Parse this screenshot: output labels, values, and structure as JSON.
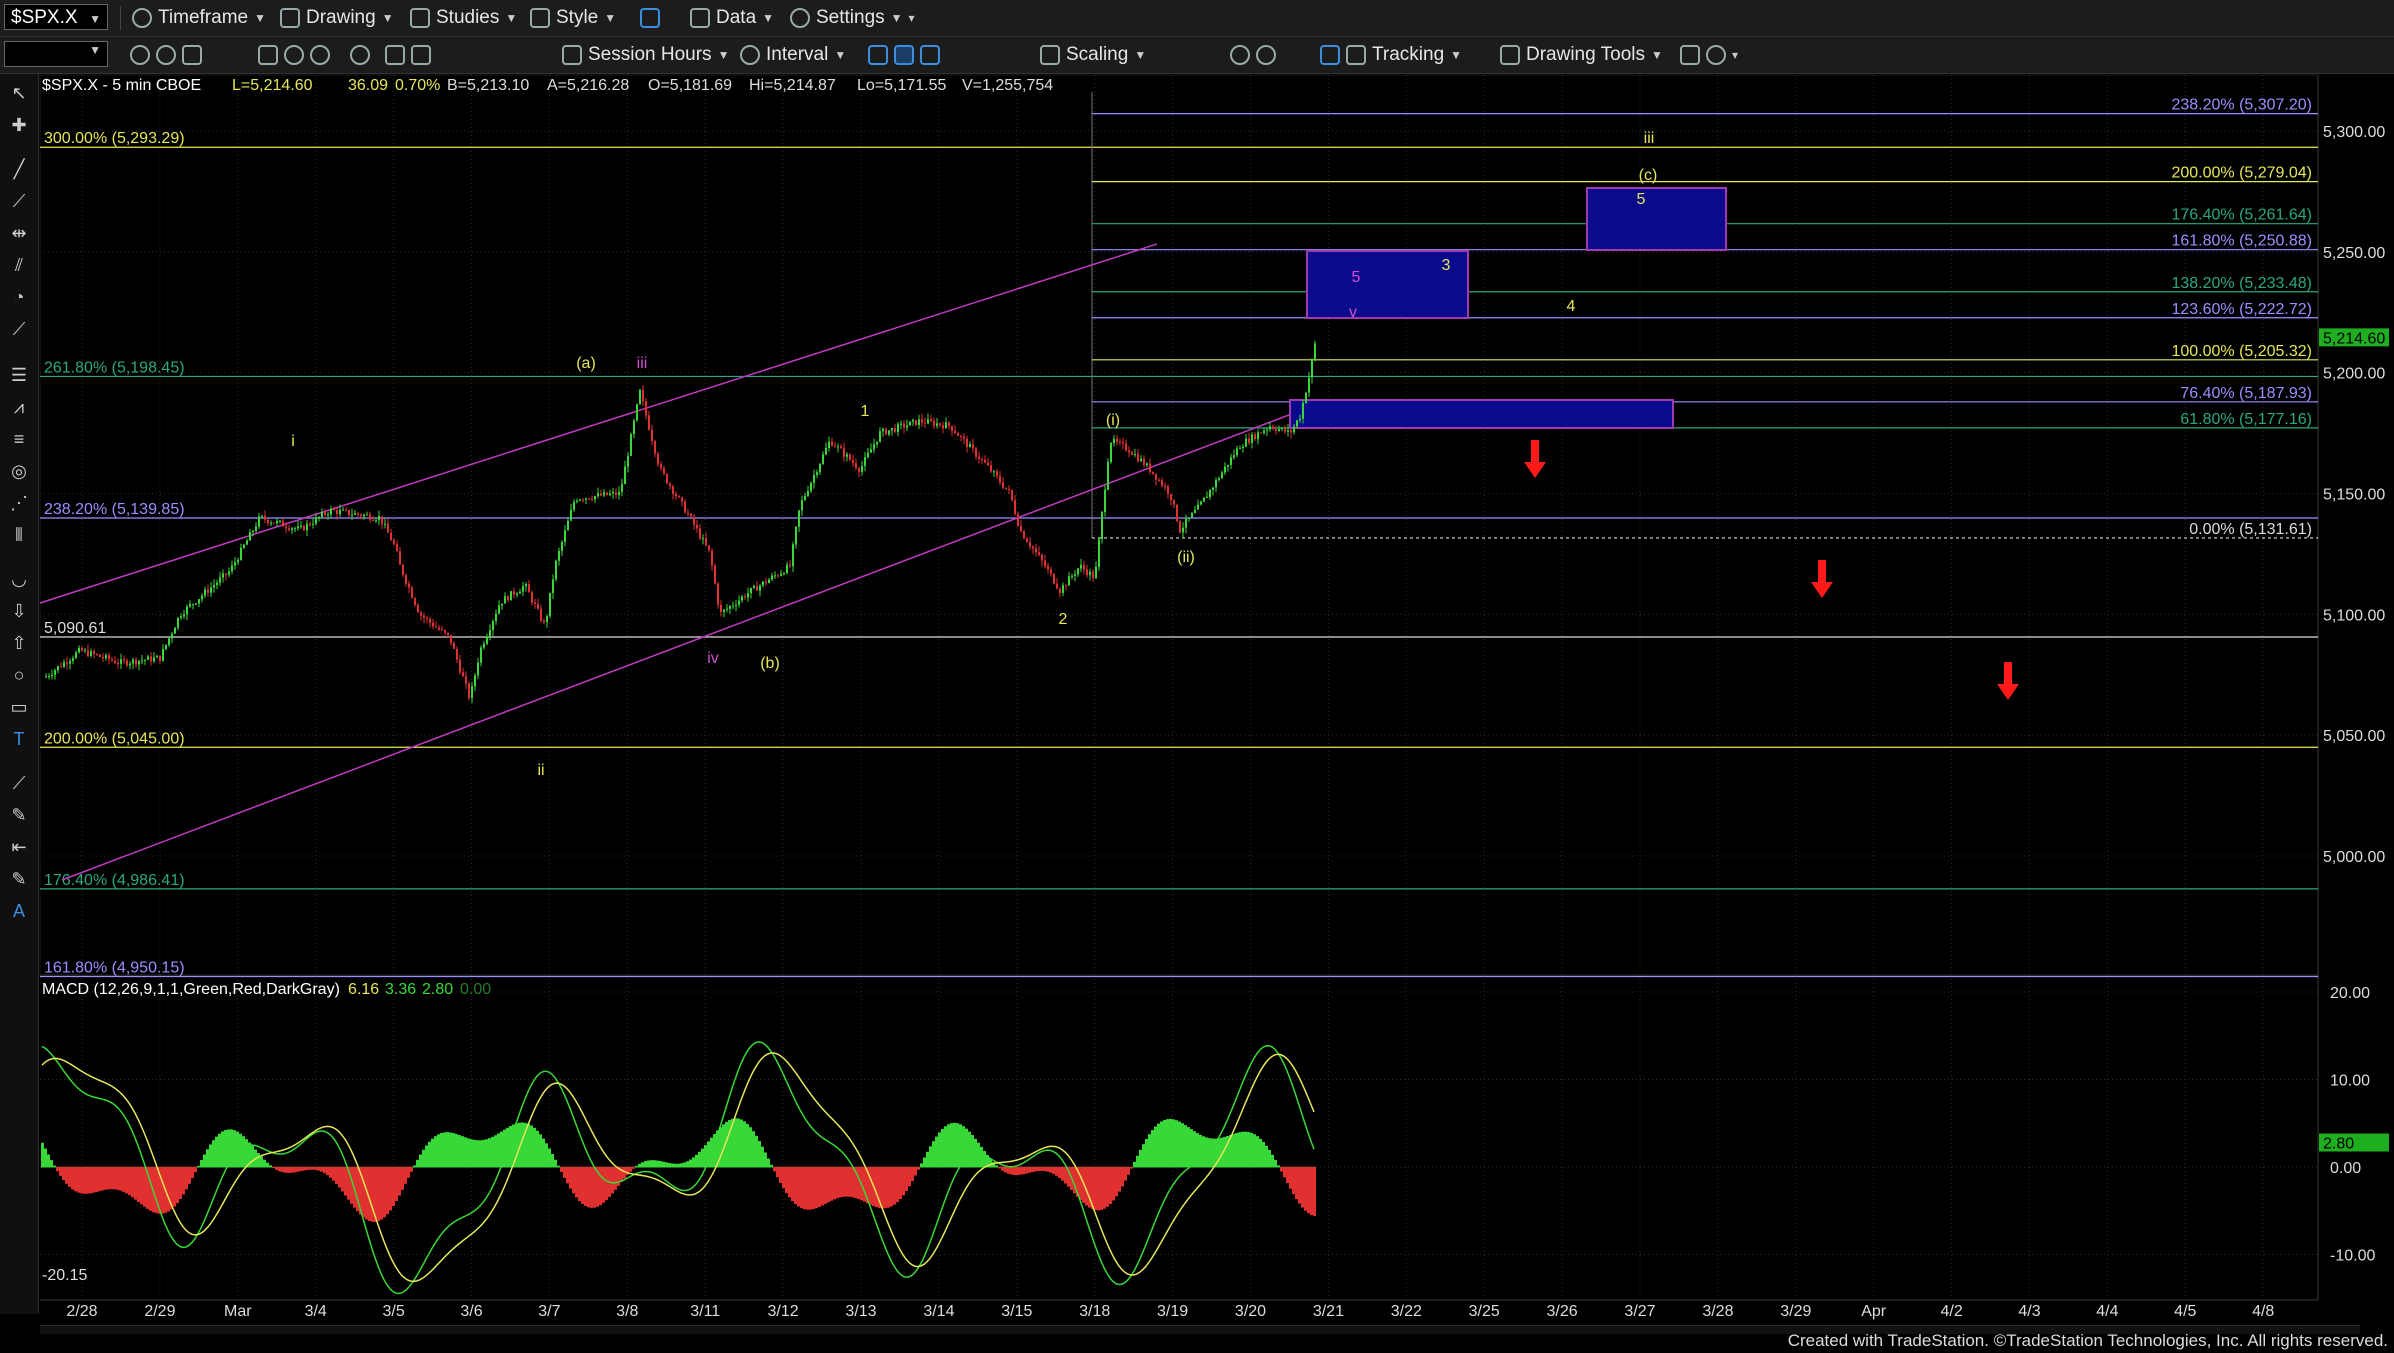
{
  "toolbar": {
    "symbol": "$SPX.X",
    "timeframe": "Timeframe",
    "drawing": "Drawing",
    "studies": "Studies",
    "style": "Style",
    "data": "Data",
    "settings": "Settings",
    "session_hours": "Session Hours",
    "interval": "Interval",
    "scaling": "Scaling",
    "tracking": "Tracking",
    "drawing_tools": "Drawing Tools"
  },
  "header": {
    "symbol_info": "$SPX.X - 5 min  CBOE",
    "last": "L=5,214.60",
    "change": "36.09",
    "pct": "0.70%",
    "bid": "B=5,213.10",
    "ask": "A=5,216.28",
    "open": "O=5,181.69",
    "hi": "Hi=5,214.87",
    "lo": "Lo=5,171.55",
    "vol": "V=1,255,754"
  },
  "price_axis": {
    "labels": [
      "5,300.00",
      "5,250.00",
      "5,200.00",
      "5,150.00",
      "5,100.00",
      "5,050.00",
      "5,000.00"
    ],
    "last_price": "5,214.60"
  },
  "date_axis": [
    "2/28",
    "2/29",
    "Mar",
    "3/4",
    "3/5",
    "3/6",
    "3/7",
    "3/8",
    "3/11",
    "3/12",
    "3/13",
    "3/14",
    "3/15",
    "3/18",
    "3/19",
    "3/20",
    "3/21",
    "3/22",
    "3/25",
    "3/26",
    "3/27",
    "3/28",
    "3/29",
    "Apr",
    "4/2",
    "4/3",
    "4/4",
    "4/5",
    "4/8"
  ],
  "fib_left": [
    {
      "label": "300.00% (5,293.29)",
      "price": 5293.29,
      "color": "#e6e65a"
    },
    {
      "label": "261.80% (5,198.45)",
      "price": 5198.45,
      "color": "#2aa884"
    },
    {
      "label": "238.20% (5,139.85)",
      "price": 5139.85,
      "color": "#9b8fff"
    },
    {
      "label": "5,090.61",
      "price": 5090.61,
      "color": "#dddddd"
    },
    {
      "label": "200.00% (5,045.00)",
      "price": 5045.0,
      "color": "#e6e65a"
    },
    {
      "label": "176.40% (4,986.41)",
      "price": 4986.41,
      "color": "#2aa884"
    },
    {
      "label": "161.80% (4,950.15)",
      "price": 4950.15,
      "color": "#9b8fff"
    }
  ],
  "fib_right": [
    {
      "label": "238.20% (5,307.20)",
      "price": 5307.2,
      "color": "#9b8fff"
    },
    {
      "label": "200.00% (5,279.04)",
      "price": 5279.04,
      "color": "#e6e65a"
    },
    {
      "label": "176.40% (5,261.64)",
      "price": 5261.64,
      "color": "#2aa884"
    },
    {
      "label": "161.80% (5,250.88)",
      "price": 5250.88,
      "color": "#9b8fff"
    },
    {
      "label": "138.20% (5,233.48)",
      "price": 5233.48,
      "color": "#2aa884"
    },
    {
      "label": "123.60% (5,222.72)",
      "price": 5222.72,
      "color": "#9b8fff"
    },
    {
      "label": "100.00% (5,205.32)",
      "price": 5205.32,
      "color": "#e6e65a"
    },
    {
      "label": "76.40% (5,187.93)",
      "price": 5187.93,
      "color": "#9b8fff"
    },
    {
      "label": "61.80% (5,177.16)",
      "price": 5177.16,
      "color": "#2aa884"
    },
    {
      "label": "0.00% (5,131.61)",
      "price": 5131.61,
      "color": "#dddddd"
    }
  ],
  "wave_labels": [
    {
      "text": "i",
      "color": "#e6e65a"
    },
    {
      "text": "(a)",
      "color": "#e6e65a"
    },
    {
      "text": "iii",
      "color": "#d24fd2"
    },
    {
      "text": "1",
      "color": "#e6e65a"
    },
    {
      "text": "iv",
      "color": "#d24fd2"
    },
    {
      "text": "(b)",
      "color": "#e6e65a"
    },
    {
      "text": "ii",
      "color": "#e6e65a"
    },
    {
      "text": "2",
      "color": "#e6e65a"
    },
    {
      "text": "(i)",
      "color": "#e6e65a"
    },
    {
      "text": "(ii)",
      "color": "#e6e65a"
    },
    {
      "text": "5",
      "color": "#d24fd2"
    },
    {
      "text": "v",
      "color": "#d24fd2"
    },
    {
      "text": "3",
      "color": "#e6e65a"
    },
    {
      "text": "4",
      "color": "#e6e65a"
    },
    {
      "text": "5",
      "color": "#e6e65a"
    },
    {
      "text": "(c)",
      "color": "#e6e65a"
    },
    {
      "text": "iii",
      "color": "#e6e65a"
    }
  ],
  "macd": {
    "title": "MACD (12,26,9,1,1,Green,Red,DarkGray)",
    "v1": "6.16",
    "v2": "3.36",
    "v3": "2.80",
    "v4": "0.00",
    "axis": [
      "20.00",
      "10.00",
      "0.00",
      "-10.00"
    ],
    "min_label": "-20.15",
    "last": "2.80"
  },
  "colors": {
    "up": "#38d838",
    "down": "#e03030",
    "fib_yellow": "#e6e65a",
    "fib_green": "#2aa884",
    "fib_purple": "#9b8fff",
    "channel": "#c03ac0",
    "target_box": "#0a0a8c",
    "arrow": "#ff1a1a"
  },
  "footer": "Created with TradeStation. ©TradeStation Technologies, Inc. All rights reserved."
}
